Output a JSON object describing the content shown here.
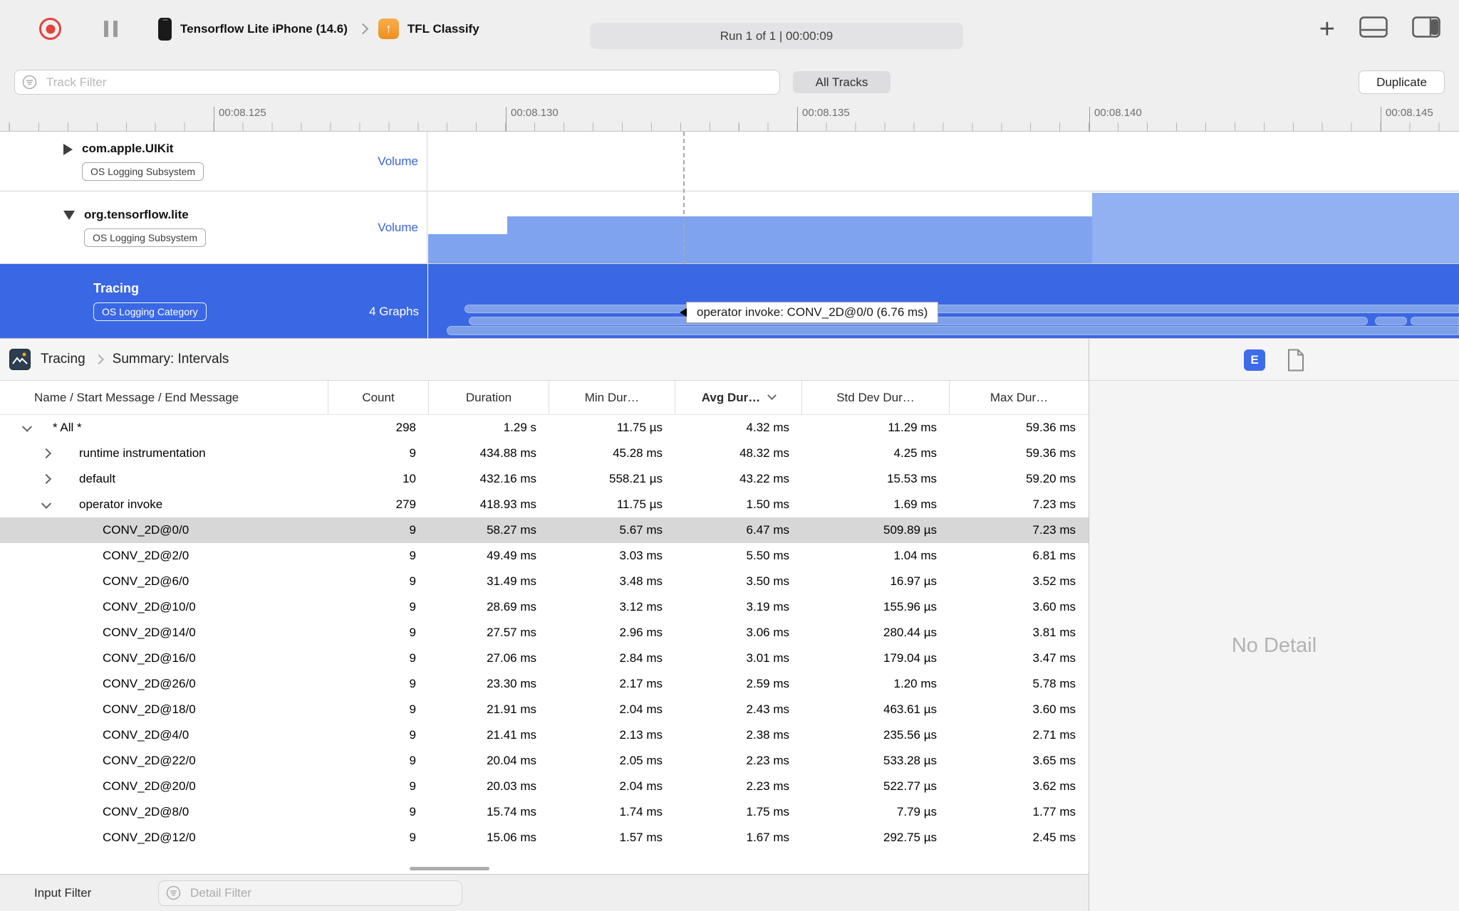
{
  "toolbar": {
    "device_name": "Tensorflow Lite iPhone (14.6)",
    "target_name": "TFL Classify",
    "run_status": "Run 1 of 1  |  00:00:09"
  },
  "filter_bar": {
    "track_filter_placeholder": "Track Filter",
    "all_tracks_label": "All Tracks",
    "duplicate_label": "Duplicate"
  },
  "ruler": {
    "labels": [
      "00:08.125",
      "00:08.130",
      "00:08.135",
      "00:08.140",
      "00:08.145"
    ]
  },
  "tracks": [
    {
      "name": "com.apple.UIKit",
      "badge": "OS Logging Subsystem",
      "meta": "Volume",
      "disclosure": "collapsed"
    },
    {
      "name": "org.tensorflow.lite",
      "badge": "OS Logging Subsystem",
      "meta": "Volume",
      "disclosure": "expanded"
    },
    {
      "name": "Tracing",
      "badge": "OS Logging Category",
      "meta": "4 Graphs",
      "disclosure": "selected"
    }
  ],
  "timeline": {
    "tooltip": "operator invoke: CONV_2D@0/0 (6.76 ms)"
  },
  "detail_header": {
    "breadcrumb_root": "Tracing",
    "breadcrumb_leaf": "Summary: Intervals",
    "e_button": "E"
  },
  "table": {
    "columns": [
      "Name / Start Message / End Message",
      "Count",
      "Duration",
      "Min Dur…",
      "Avg Dur…",
      "Std Dev Dur…",
      "Max Dur…"
    ],
    "rows": [
      {
        "level": 0,
        "disclosure": "open",
        "selected": false,
        "name": "* All *",
        "count": "298",
        "duration": "1.29 s",
        "min": "11.75 µs",
        "avg": "4.32 ms",
        "std": "11.29 ms",
        "max": "59.36 ms"
      },
      {
        "level": 1,
        "disclosure": "closed",
        "selected": false,
        "name": "runtime instrumentation",
        "count": "9",
        "duration": "434.88 ms",
        "min": "45.28 ms",
        "avg": "48.32 ms",
        "std": "4.25 ms",
        "max": "59.36 ms"
      },
      {
        "level": 1,
        "disclosure": "closed",
        "selected": false,
        "name": "default",
        "count": "10",
        "duration": "432.16 ms",
        "min": "558.21 µs",
        "avg": "43.22 ms",
        "std": "15.53 ms",
        "max": "59.20 ms"
      },
      {
        "level": 1,
        "disclosure": "open",
        "selected": false,
        "name": "operator invoke",
        "count": "279",
        "duration": "418.93 ms",
        "min": "11.75 µs",
        "avg": "1.50 ms",
        "std": "1.69 ms",
        "max": "7.23 ms"
      },
      {
        "level": 2,
        "disclosure": null,
        "selected": true,
        "name": "CONV_2D@0/0",
        "count": "9",
        "duration": "58.27 ms",
        "min": "5.67 ms",
        "avg": "6.47 ms",
        "std": "509.89 µs",
        "max": "7.23 ms"
      },
      {
        "level": 2,
        "disclosure": null,
        "selected": false,
        "name": "CONV_2D@2/0",
        "count": "9",
        "duration": "49.49 ms",
        "min": "3.03 ms",
        "avg": "5.50 ms",
        "std": "1.04 ms",
        "max": "6.81 ms"
      },
      {
        "level": 2,
        "disclosure": null,
        "selected": false,
        "name": "CONV_2D@6/0",
        "count": "9",
        "duration": "31.49 ms",
        "min": "3.48 ms",
        "avg": "3.50 ms",
        "std": "16.97 µs",
        "max": "3.52 ms"
      },
      {
        "level": 2,
        "disclosure": null,
        "selected": false,
        "name": "CONV_2D@10/0",
        "count": "9",
        "duration": "28.69 ms",
        "min": "3.12 ms",
        "avg": "3.19 ms",
        "std": "155.96 µs",
        "max": "3.60 ms"
      },
      {
        "level": 2,
        "disclosure": null,
        "selected": false,
        "name": "CONV_2D@14/0",
        "count": "9",
        "duration": "27.57 ms",
        "min": "2.96 ms",
        "avg": "3.06 ms",
        "std": "280.44 µs",
        "max": "3.81 ms"
      },
      {
        "level": 2,
        "disclosure": null,
        "selected": false,
        "name": "CONV_2D@16/0",
        "count": "9",
        "duration": "27.06 ms",
        "min": "2.84 ms",
        "avg": "3.01 ms",
        "std": "179.04 µs",
        "max": "3.47 ms"
      },
      {
        "level": 2,
        "disclosure": null,
        "selected": false,
        "name": "CONV_2D@26/0",
        "count": "9",
        "duration": "23.30 ms",
        "min": "2.17 ms",
        "avg": "2.59 ms",
        "std": "1.20 ms",
        "max": "5.78 ms"
      },
      {
        "level": 2,
        "disclosure": null,
        "selected": false,
        "name": "CONV_2D@18/0",
        "count": "9",
        "duration": "21.91 ms",
        "min": "2.04 ms",
        "avg": "2.43 ms",
        "std": "463.61 µs",
        "max": "3.60 ms"
      },
      {
        "level": 2,
        "disclosure": null,
        "selected": false,
        "name": "CONV_2D@4/0",
        "count": "9",
        "duration": "21.41 ms",
        "min": "2.13 ms",
        "avg": "2.38 ms",
        "std": "235.56 µs",
        "max": "2.71 ms"
      },
      {
        "level": 2,
        "disclosure": null,
        "selected": false,
        "name": "CONV_2D@22/0",
        "count": "9",
        "duration": "20.04 ms",
        "min": "2.05 ms",
        "avg": "2.23 ms",
        "std": "533.28 µs",
        "max": "3.65 ms"
      },
      {
        "level": 2,
        "disclosure": null,
        "selected": false,
        "name": "CONV_2D@20/0",
        "count": "9",
        "duration": "20.03 ms",
        "min": "2.04 ms",
        "avg": "2.23 ms",
        "std": "522.77 µs",
        "max": "3.62 ms"
      },
      {
        "level": 2,
        "disclosure": null,
        "selected": false,
        "name": "CONV_2D@8/0",
        "count": "9",
        "duration": "15.74 ms",
        "min": "1.74 ms",
        "avg": "1.75 ms",
        "std": "7.79 µs",
        "max": "1.77 ms"
      },
      {
        "level": 2,
        "disclosure": null,
        "selected": false,
        "name": "CONV_2D@12/0",
        "count": "9",
        "duration": "15.06 ms",
        "min": "1.57 ms",
        "avg": "1.67 ms",
        "std": "292.75 µs",
        "max": "2.45 ms"
      }
    ]
  },
  "right_panel": {
    "empty_message": "No Detail"
  },
  "bottom_bar": {
    "label": "Input Filter",
    "detail_filter_placeholder": "Detail Filter"
  }
}
